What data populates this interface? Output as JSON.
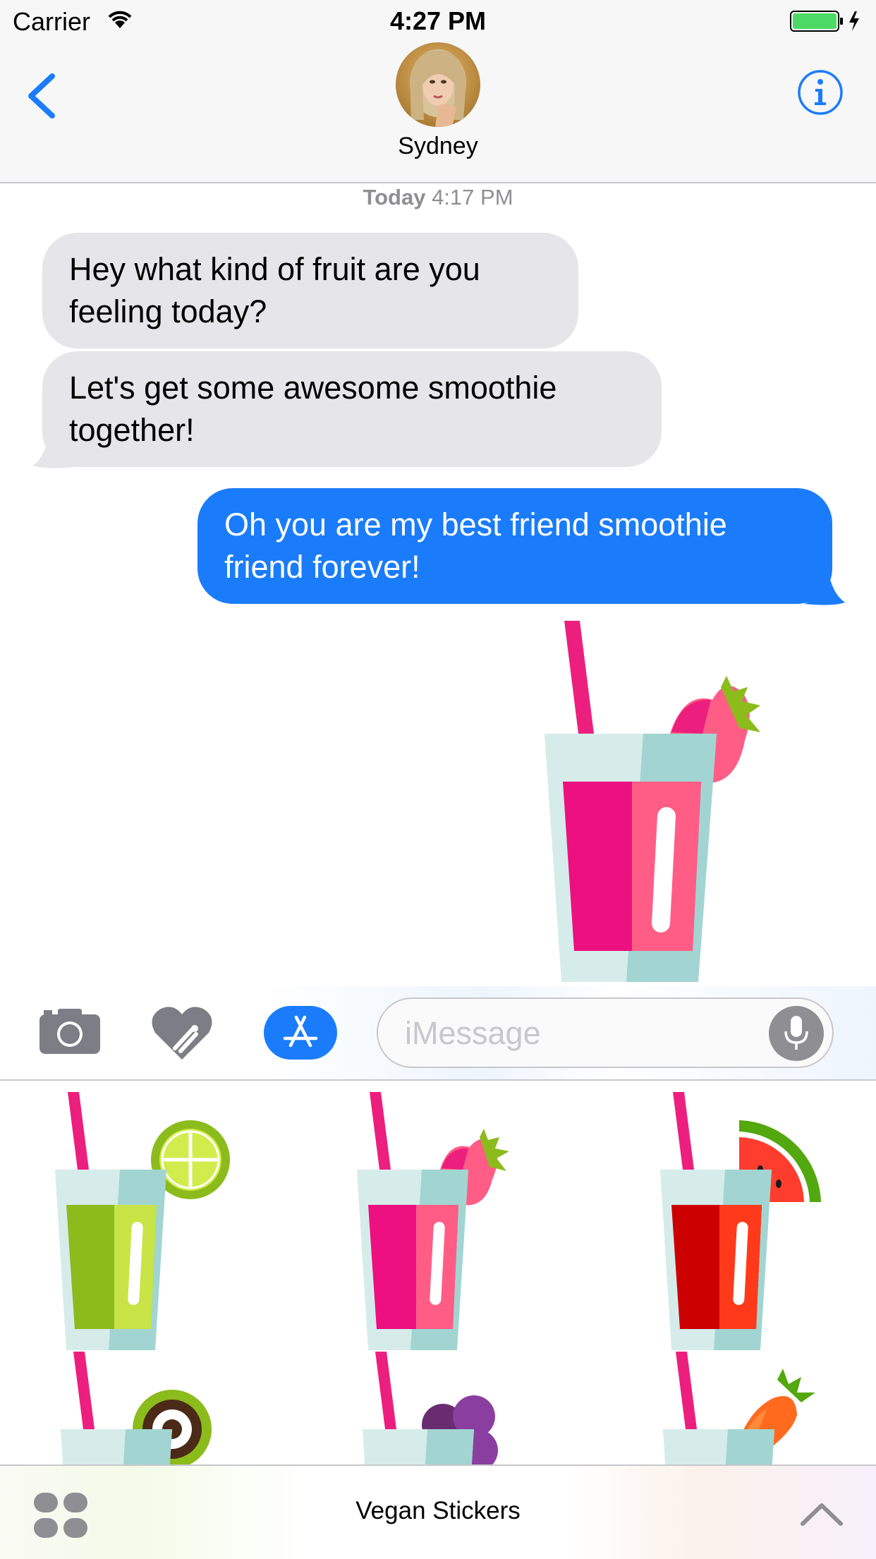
{
  "status_bar": {
    "carrier": "Carrier",
    "time": "4:27 PM",
    "icons": [
      "wifi-icon",
      "battery-icon",
      "charging-bolt-icon"
    ]
  },
  "nav": {
    "contact_name": "Sydney",
    "back_icon": "chevron-left-icon",
    "info_icon": "info-icon"
  },
  "conversation": {
    "timestamp_day": "Today",
    "timestamp_time": "4:17 PM",
    "messages": [
      {
        "direction": "incoming",
        "text": "Hey what kind of fruit are you feeling today?"
      },
      {
        "direction": "incoming",
        "text": "Let's get some awesome smoothie together!"
      },
      {
        "direction": "outgoing",
        "text": "Oh you are my best friend smoothie friend forever!"
      }
    ],
    "sent_sticker": "strawberry-smoothie-sticker"
  },
  "input_bar": {
    "placeholder": "iMessage",
    "icons": [
      "camera-icon",
      "digital-touch-heart-icon",
      "app-store-icon",
      "microphone-icon"
    ]
  },
  "sticker_drawer": {
    "stickers": [
      "lime-smoothie-sticker",
      "strawberry-smoothie-sticker",
      "watermelon-smoothie-sticker",
      "kiwi-smoothie-sticker",
      "grape-smoothie-sticker",
      "carrot-smoothie-sticker"
    ]
  },
  "bottom_bar": {
    "app_name": "Vegan Stickers",
    "icons": [
      "app-drawer-icon",
      "chevron-up-icon"
    ]
  },
  "colors": {
    "ios_blue": "#1a7cfa",
    "incoming_bubble": "#e5e5ea",
    "straw": "#ec1f7e",
    "glass": "#d6ecea"
  }
}
